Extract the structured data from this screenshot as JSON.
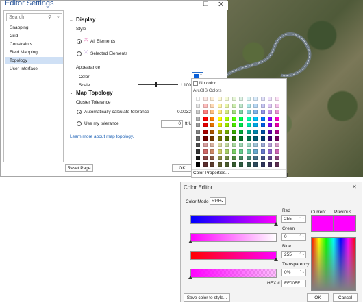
{
  "editor": {
    "title": "Editor Settings",
    "restore_icon": "□",
    "close_icon": "✕",
    "search_placeholder": "Search",
    "nav": [
      "Snapping",
      "Grid",
      "Constraints",
      "Field Mapping",
      "Topology",
      "User Interface"
    ],
    "selected_nav": "Topology",
    "display_header": "Display",
    "style_label": "Style",
    "all_elements": "All Elements",
    "selected_elements": "Selected Elements",
    "appearance_label": "Appearance",
    "color_label": "Color",
    "scale_label": "Scale",
    "scale_minus": "−",
    "scale_plus": "+",
    "scale_value": "100%",
    "map_topology_header": "Map Topology",
    "cluster_label": "Cluster Tolerance",
    "auto_tol": "Automatically calculate tolerance",
    "auto_tol_value": "0.00328",
    "use_tol": "Use my tolerance",
    "my_tol_value": "0",
    "my_tol_unit": "ft US",
    "learn_more": "Learn more about map topology.",
    "reset_page": "Reset Page",
    "ok": "OK"
  },
  "palette": {
    "no_color": "No color",
    "section": "ArcGIS Colors",
    "color_properties": "Color Properties...",
    "rows": [
      [
        "#ffffff",
        "#fde9e5",
        "#fff0d9",
        "#fffbd6",
        "#f5fbd6",
        "#e6f6d6",
        "#dff4e6",
        "#d9f2f2",
        "#d9ebfb",
        "#e0e0fb",
        "#eee0fb",
        "#fbe0f5"
      ],
      [
        "#e6e6e6",
        "#ffbebe",
        "#ffd9b3",
        "#fff5a8",
        "#e8f5a8",
        "#cdeeb0",
        "#bfe8cc",
        "#b0e6e6",
        "#b8d9f5",
        "#c7c7f5",
        "#dfc7f5",
        "#f5c7eb"
      ],
      [
        "#cccccc",
        "#ff7f7f",
        "#ffbf7f",
        "#ffeb7f",
        "#d4eb7f",
        "#a3dc7f",
        "#7fd4a6",
        "#7fd4d4",
        "#7fb4e8",
        "#9393e8",
        "#c293e8",
        "#e893d4"
      ],
      [
        "#b2b2b2",
        "#ff0000",
        "#ff8000",
        "#ffff00",
        "#aaff00",
        "#55ff00",
        "#00ff55",
        "#00ffaa",
        "#00c5ff",
        "#0070ff",
        "#8800ff",
        "#ff00c5"
      ],
      [
        "#9c9c9c",
        "#e60000",
        "#e67300",
        "#e6e600",
        "#98e600",
        "#4ce600",
        "#00e64c",
        "#00e6a9",
        "#00a9e6",
        "#005ce6",
        "#7a00e6",
        "#e600a9"
      ],
      [
        "#828282",
        "#a80000",
        "#a85300",
        "#a8a800",
        "#70a800",
        "#38a800",
        "#00a838",
        "#00a884",
        "#0084a8",
        "#004da8",
        "#5a00a8",
        "#a80084"
      ],
      [
        "#686868",
        "#730000",
        "#733900",
        "#737300",
        "#4c7300",
        "#267300",
        "#007326",
        "#00734c",
        "#005c73",
        "#003473",
        "#3c0073",
        "#73005c"
      ],
      [
        "#4e4e4e",
        "#d79e9e",
        "#d7b09e",
        "#d7d79e",
        "#c1d79e",
        "#a8d79e",
        "#9ed7b4",
        "#9ed7c2",
        "#9ec4d7",
        "#9eaad7",
        "#b69ed7",
        "#d79ec9"
      ],
      [
        "#343434",
        "#cd6666",
        "#cd8966",
        "#cdcd66",
        "#a5cd66",
        "#7acd66",
        "#66cd8e",
        "#66cdab",
        "#66a9cd",
        "#6677cd",
        "#8d66cd",
        "#cd66b4"
      ],
      [
        "#1a1a1a",
        "#894444",
        "#895a44",
        "#898944",
        "#6e8944",
        "#518944",
        "#44895f",
        "#448972",
        "#447089",
        "#444f89",
        "#5e4489",
        "#894478"
      ],
      [
        "#000000",
        "#5c2e2e",
        "#5c3d2e",
        "#5c5c2e",
        "#4a5c2e",
        "#365c2e",
        "#2e5c40",
        "#2e5c4c",
        "#2e4b5c",
        "#2e355c",
        "#3f2e5c",
        "#5c2e51"
      ]
    ]
  },
  "color_editor": {
    "title": "Color Editor",
    "close_icon": "✕",
    "mode_label": "Color Mode",
    "mode_value": "RGB",
    "red_label": "Red",
    "red_value": "255",
    "green_label": "Green",
    "green_value": "0",
    "blue_label": "Blue",
    "blue_value": "255",
    "transparency_label": "Transparency",
    "transparency_value": "0%",
    "hex_label": "HEX #",
    "hex_value": "FF00FF",
    "current_label": "Current",
    "previous_label": "Previous",
    "current_color": "#ff00ff",
    "previous_color": "#ff00ff",
    "save_btn": "Save color to style...",
    "ok": "OK",
    "cancel": "Cancel"
  }
}
